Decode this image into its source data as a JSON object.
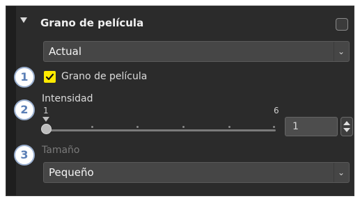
{
  "section": {
    "title": "Grano de película",
    "preset": {
      "selected": "Actual"
    }
  },
  "grain_checkbox": {
    "label": "Grano de película",
    "checked": true
  },
  "intensity": {
    "label": "Intensidad",
    "min_label": "1",
    "max_label": "6",
    "value": "1",
    "level": 1,
    "range": [
      1,
      6
    ]
  },
  "size": {
    "label": "Tamaño",
    "selected": "Pequeño"
  },
  "callouts": [
    "1",
    "2",
    "3"
  ],
  "colors": {
    "accent_checkbox": "#ffea00",
    "panel_bg": "#2b2b2b",
    "callout_text": "#5b7fb6",
    "callout_border": "#9bb0d0"
  },
  "icons": {
    "collapse": "triangle-down-icon",
    "dropdown": "chevron-down-icon",
    "stepper": "up-down-arrows-icon",
    "check": "checkmark-icon"
  }
}
